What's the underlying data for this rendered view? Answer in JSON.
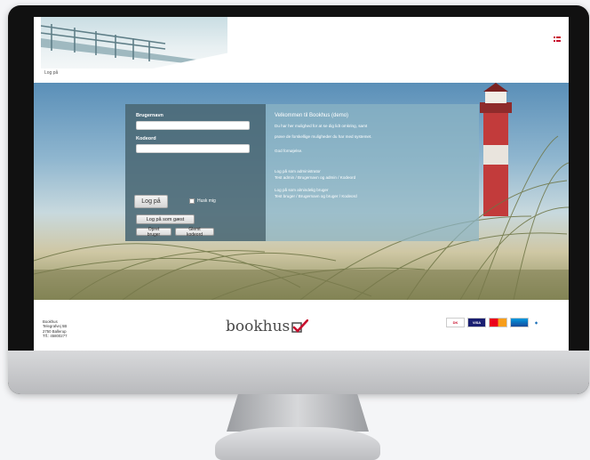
{
  "breadcrumb": "Log på",
  "login": {
    "username_label": "Brugernavn",
    "password_label": "Kodeord",
    "login_button": "Log på",
    "remember_label": "Husk mig",
    "guest_button": "Log på som gæst",
    "create_user_button": "Opret bruger",
    "forgot_password_button": "Glemt kodeord"
  },
  "info": {
    "title": "Velkommen til Bookhus (demo)",
    "line1": "Du har her mulighed for at se dig lidt omkring, samt",
    "line2": "prøve de forskellige muligheder du har med systemet.",
    "line3": "God fornøjelse.",
    "admin_heading": "Log på som administrator",
    "admin_detail": "Test admin / Brugernavn og admin / Kodeord",
    "user_heading": "Log på som almindelig bruger",
    "user_detail": "Test bruger / Brugernavn og bruger / Kodeord"
  },
  "footer": {
    "address": [
      "Bookhus",
      "Telegrafvej 5B",
      "2750 Ballerup",
      "Tlf.: 45800277"
    ],
    "logo_text": "bookhus",
    "payment_cards": [
      "Dankort",
      "VISA",
      "MasterCard",
      "Maestro",
      "JCB"
    ]
  },
  "colors": {
    "login_panel": "#4a6874",
    "info_panel": "#8cb4c3",
    "logo_check": "#c8102e"
  }
}
